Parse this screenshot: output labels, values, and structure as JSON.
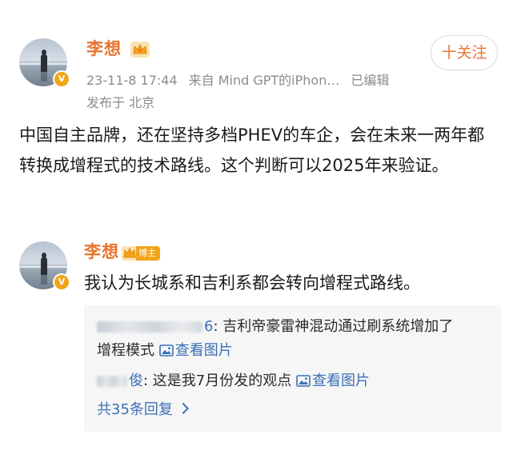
{
  "post": {
    "author": "李想",
    "follow_label": "十关注",
    "timestamp": "23-11-8 17:44",
    "source": "来自 Mind GPT的iPhon…",
    "edited": "已编辑",
    "location": "发布于 北京",
    "content": "中国自主品牌，还在坚持多档PHEV的车企，会在未来一两年都转换成增程式的技术路线。这个判断可以2025年来验证。",
    "verified_icon": "verified-badge-icon",
    "crown_icon": "crown-icon"
  },
  "comment": {
    "author": "李想",
    "badge_label": "博主",
    "text": "我认为长城系和吉利系都会转向增程式路线。",
    "replies": [
      {
        "user_tail": "6",
        "text_line1": "吉利帝豪雷神混动通过刷系统增加了",
        "text_line2": "增程模式",
        "pic_label": "查看图片"
      },
      {
        "user_tail": "俊",
        "text": "这是我7月份发的观点",
        "pic_label": "查看图片"
      }
    ],
    "more_replies": "共35条回复"
  },
  "colors": {
    "accent": "#e8742f",
    "link": "#3b6fb6",
    "meta": "#8c8c8c",
    "badge": "#f3a417"
  }
}
